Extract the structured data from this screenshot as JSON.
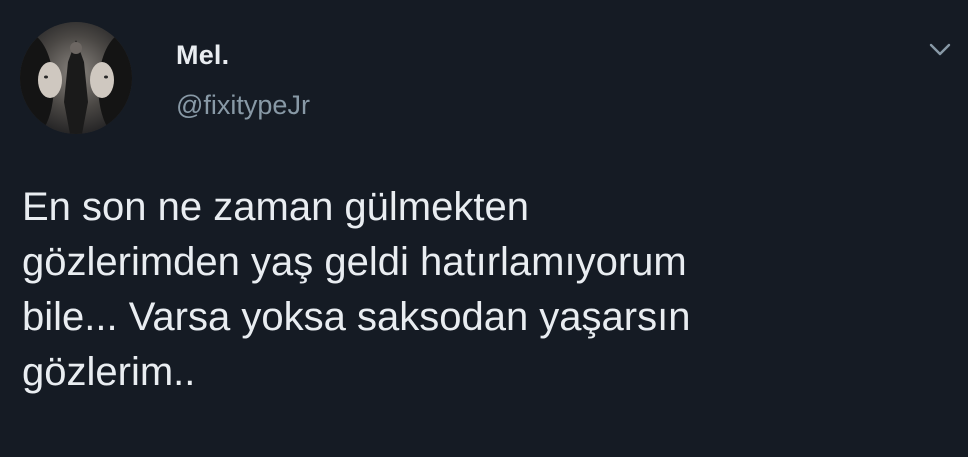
{
  "author": {
    "display_name": "Mel.",
    "handle": "@fixitypeJr",
    "avatar_icon": "avatar-portrait-mirrored"
  },
  "tweet": {
    "text": "En son ne zaman gülmekten\ngözlerimden yaş geldi hatırlamıyorum\nbile... Varsa yoksa saksodan yaşarsın\ngözlerim.."
  },
  "menu": {
    "icon": "chevron-down-icon"
  },
  "colors": {
    "background": "#151b24",
    "primary_text": "#e9edf1",
    "secondary_text": "#8899a6",
    "icon": "#8899a6"
  }
}
